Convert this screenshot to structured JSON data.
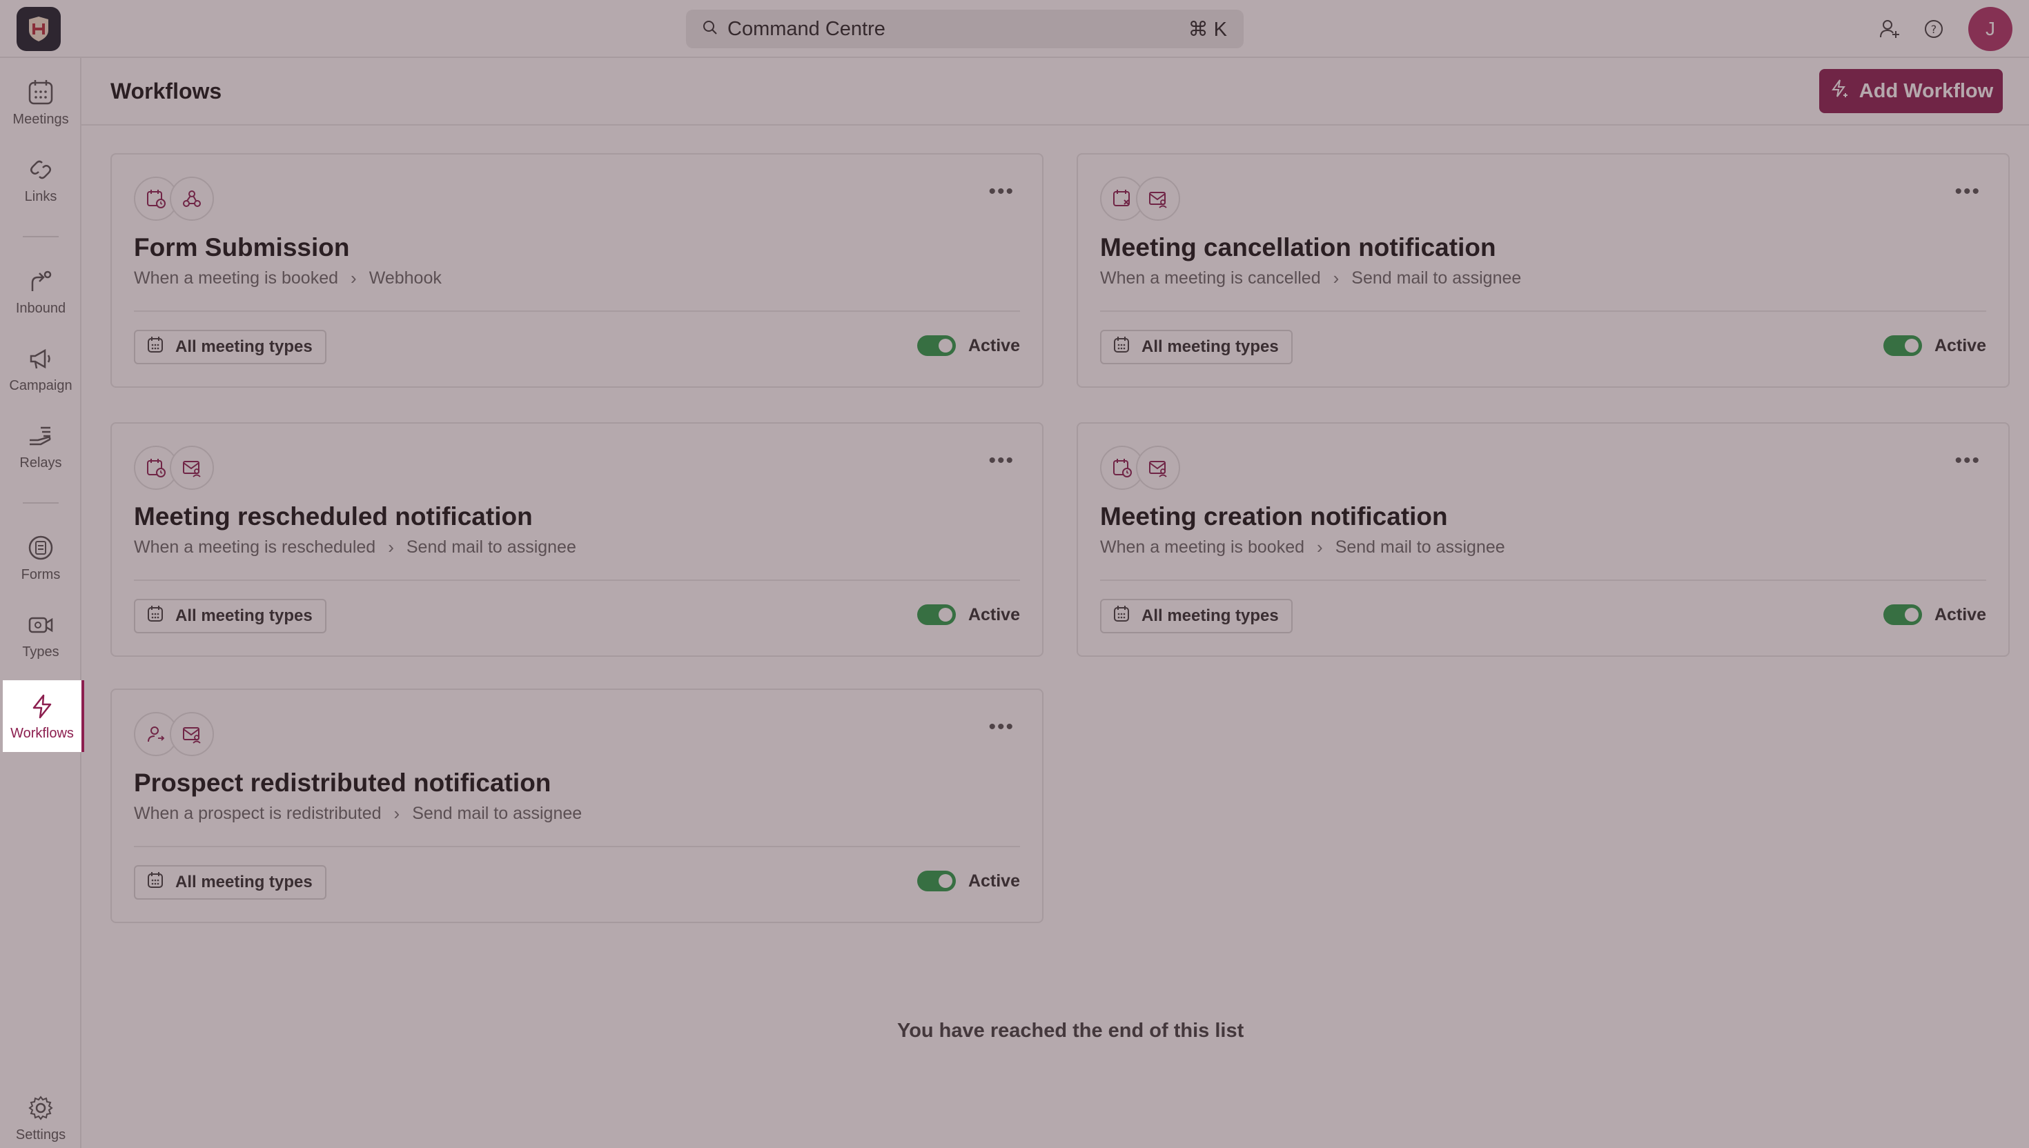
{
  "app": {
    "logo_icon": "brand-logo-icon",
    "search": {
      "label": "Command Centre",
      "shortcut": "⌘ K",
      "icon": "search-icon"
    },
    "top_icons": [
      "add-user-icon",
      "help-icon"
    ],
    "avatar_initial": "J",
    "accent_color": "#8c2454",
    "active_color": "#2e9e4e"
  },
  "sidebar": {
    "items": [
      {
        "label": "Meetings",
        "icon": "calendar-icon"
      },
      {
        "label": "Links",
        "icon": "link-icon"
      },
      {
        "label": "Inbound",
        "icon": "inbound-icon"
      },
      {
        "label": "Campaign",
        "icon": "megaphone-icon"
      },
      {
        "label": "Relays",
        "icon": "relay-hand-icon"
      },
      {
        "label": "Forms",
        "icon": "forms-icon"
      },
      {
        "label": "Types",
        "icon": "video-icon"
      },
      {
        "label": "Workflows",
        "icon": "lightning-icon",
        "active": true
      },
      {
        "label": "Settings",
        "icon": "gear-icon"
      }
    ]
  },
  "header": {
    "title": "Workflows",
    "add_button": "Add Workflow"
  },
  "cards": [
    {
      "title": "Form Submission",
      "trigger": "When a meeting is booked",
      "action": "Webhook",
      "icons": [
        "calendar-clock-icon",
        "webhook-icon"
      ],
      "tag": "All meeting types",
      "status": "Active"
    },
    {
      "title": "Meeting cancellation notification",
      "trigger": "When a meeting is cancelled",
      "action": "Send mail to assignee",
      "icons": [
        "calendar-x-icon",
        "mail-user-icon"
      ],
      "tag": "All meeting types",
      "status": "Active"
    },
    {
      "title": "Meeting rescheduled notification",
      "trigger": "When a meeting is rescheduled",
      "action": "Send mail to assignee",
      "icons": [
        "calendar-clock-icon",
        "mail-user-icon"
      ],
      "tag": "All meeting types",
      "status": "Active"
    },
    {
      "title": "Meeting creation notification",
      "trigger": "When a meeting is booked",
      "action": "Send mail to assignee",
      "icons": [
        "calendar-clock-icon",
        "mail-user-icon"
      ],
      "tag": "All meeting types",
      "status": "Active"
    },
    {
      "title": "Prospect redistributed notification",
      "trigger": "When a prospect is redistributed",
      "action": "Send mail to assignee",
      "icons": [
        "user-swap-icon",
        "mail-user-icon"
      ],
      "tag": "All meeting types",
      "status": "Active"
    }
  ],
  "end_message": "You have reached the end of this list"
}
